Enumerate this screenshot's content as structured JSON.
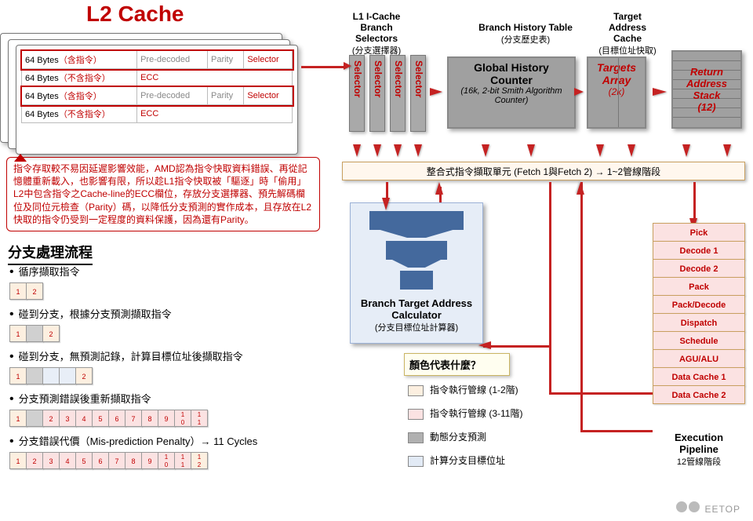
{
  "l2": {
    "header": "L2 Cache",
    "rows": [
      {
        "b": "64 Bytes",
        "tag": "（含指令）",
        "c2": "Pre-decoded",
        "c3": "Parity",
        "c4": "Selector",
        "hl": true
      },
      {
        "b": "64 Bytes",
        "tag": "（不含指令）",
        "c2": "ECC",
        "c3": "",
        "c4": "",
        "hl": false
      },
      {
        "b": "64 Bytes",
        "tag": "（含指令）",
        "c2": "Pre-decoded",
        "c3": "Parity",
        "c4": "Selector",
        "hl": true
      },
      {
        "b": "64 Bytes",
        "tag": "（不含指令）",
        "c2": "ECC",
        "c3": "",
        "c4": "",
        "hl": false
      }
    ]
  },
  "note": "指令存取較不易因延遲影響效能，AMD認為指令快取資料錯誤、再從記憶體重新載入，也影響有限，所以趁L1指令快取被「驅逐」時「偷用」L2中包含指令之Cache-line的ECC欄位，存放分支選擇器、預先解碼欄位及同位元檢查（Parity）碼，以降低分支預測的實作成本，且存放在L2快取的指令仍受到一定程度的資料保護，因為還有Parity。",
  "section_h": "分支處理流程",
  "flow": {
    "s1": "循序擷取指令",
    "s2": "碰到分支，根據分支預測擷取指令",
    "s3": "碰到分支，無預測記錄，計算目標位址後擷取指令",
    "s4": "分支預測錯誤後重新擷取指令",
    "s5": "分支錯誤代價（Mis-prediction Penalty）→ 11 Cycles"
  },
  "blocks": {
    "bs_title1": "L1 I-Cache",
    "bs_title2": "Branch",
    "bs_title3": "Selectors",
    "bs_sub": "(分支選擇器)",
    "selector": "Selector",
    "bht_title": "Branch  History Table",
    "bht_sub": "(分支歷史表)",
    "ghc": "Global History Counter",
    "ghc_sub": "(16k, 2-bit Smith Algorithm Counter)",
    "tac_title1": "Target",
    "tac_title2": "Address",
    "tac_title3": "Cache",
    "tac_sub": "(目標位址快取)",
    "targets": "Targets Array",
    "targets_k": "(2k)",
    "ras1": "Return",
    "ras2": "Address",
    "ras3": "Stack",
    "ras_n": "(12)"
  },
  "fetchbar": "整合式指令擷取單元 (Fetch 1與Fetch 2) → 1~2管線階段",
  "btac": {
    "cap": "Branch Target Address Calculator",
    "sub": "(分支目標位址計算器)"
  },
  "legend": {
    "h": "顏色代表什麼？",
    "a": "指令執行管線 (1-2階)",
    "b": "指令執行管線 (3-11階)",
    "c": "動態分支預測",
    "d": "計算分支目標位址"
  },
  "pipe": {
    "stages": [
      "Pick",
      "Decode 1",
      "Decode 2",
      "Pack",
      "Pack/Decode",
      "Dispatch",
      "Schedule",
      "AGU/ALU",
      "Data Cache 1",
      "Data Cache 2"
    ],
    "cap1": "Execution",
    "cap2": "Pipeline",
    "cap3": "12管線階段"
  },
  "watermark": "EETOP"
}
